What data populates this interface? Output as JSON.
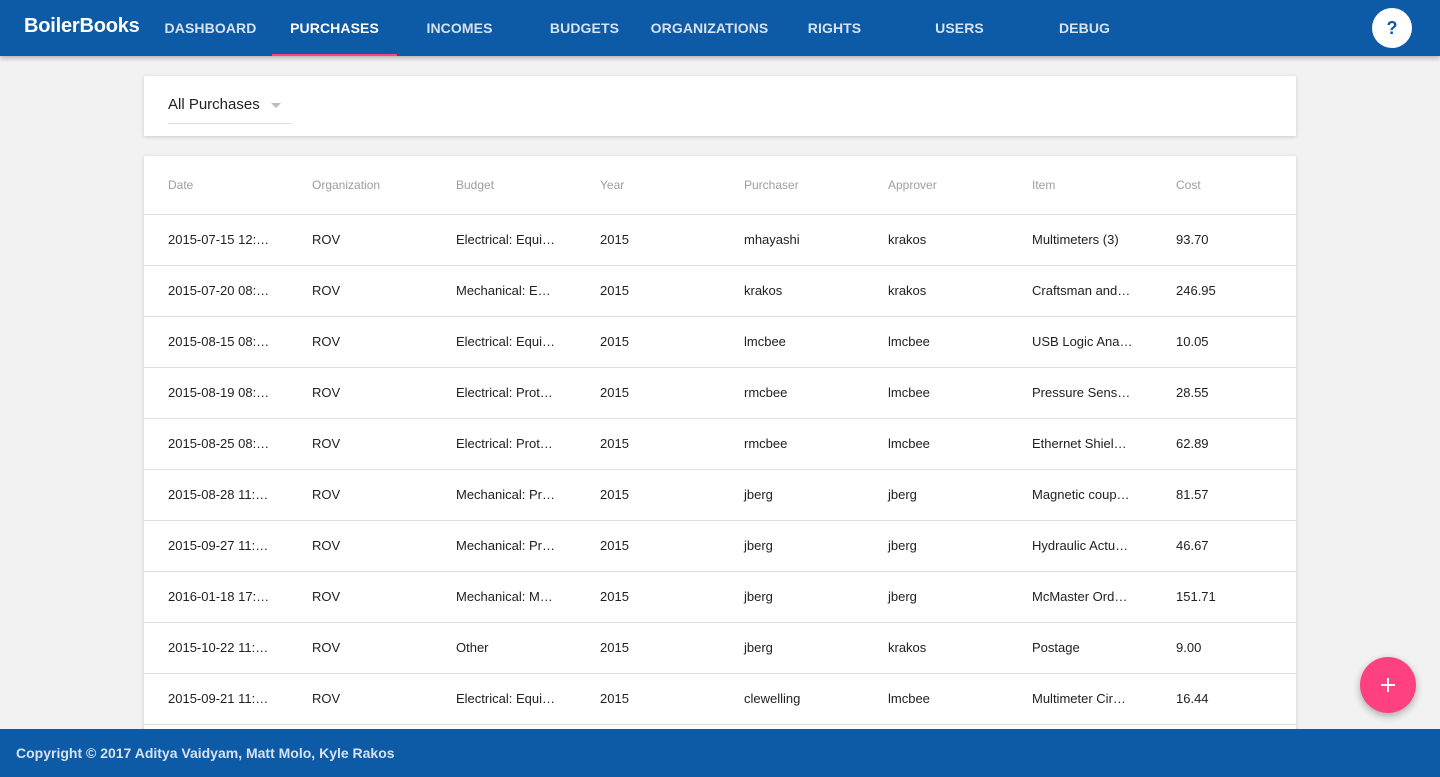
{
  "app": {
    "title": "BoilerBooks"
  },
  "nav": {
    "tabs": [
      {
        "label": "DASHBOARD"
      },
      {
        "label": "PURCHASES",
        "active": true
      },
      {
        "label": "INCOMES"
      },
      {
        "label": "BUDGETS"
      },
      {
        "label": "ORGANIZATIONS"
      },
      {
        "label": "RIGHTS"
      },
      {
        "label": "USERS"
      },
      {
        "label": "DEBUG"
      }
    ],
    "help_label": "?"
  },
  "filter": {
    "selected": "All Purchases"
  },
  "table": {
    "columns": [
      "Date",
      "Organization",
      "Budget",
      "Year",
      "Purchaser",
      "Approver",
      "Item",
      "Cost"
    ],
    "rows": [
      [
        "2015-07-15 12:…",
        "ROV",
        "Electrical: Equi…",
        "2015",
        "mhayashi",
        "krakos",
        "Multimeters (3)",
        "93.70"
      ],
      [
        "2015-07-20 08:…",
        "ROV",
        "Mechanical: E…",
        "2015",
        "krakos",
        "krakos",
        "Craftsman and…",
        "246.95"
      ],
      [
        "2015-08-15 08:…",
        "ROV",
        "Electrical: Equi…",
        "2015",
        "lmcbee",
        "lmcbee",
        "USB Logic Ana…",
        "10.05"
      ],
      [
        "2015-08-19 08:…",
        "ROV",
        "Electrical: Prot…",
        "2015",
        "rmcbee",
        "lmcbee",
        "Pressure Sens…",
        "28.55"
      ],
      [
        "2015-08-25 08:…",
        "ROV",
        "Electrical: Prot…",
        "2015",
        "rmcbee",
        "lmcbee",
        "Ethernet Shiel…",
        "62.89"
      ],
      [
        "2015-08-28 11:…",
        "ROV",
        "Mechanical: Pr…",
        "2015",
        "jberg",
        "jberg",
        "Magnetic coup…",
        "81.57"
      ],
      [
        "2015-09-27 11:…",
        "ROV",
        "Mechanical: Pr…",
        "2015",
        "jberg",
        "jberg",
        "Hydraulic Actu…",
        "46.67"
      ],
      [
        "2016-01-18 17:…",
        "ROV",
        "Mechanical: M…",
        "2015",
        "jberg",
        "jberg",
        "McMaster Ord…",
        "151.71"
      ],
      [
        "2015-10-22 11:…",
        "ROV",
        "Other",
        "2015",
        "jberg",
        "krakos",
        "Postage",
        "9.00"
      ],
      [
        "2015-09-21 11:…",
        "ROV",
        "Electrical: Equi…",
        "2015",
        "clewelling",
        "lmcbee",
        "Multimeter Cir…",
        "16.44"
      ]
    ]
  },
  "footer": {
    "copyright": "Copyright © 2017 Aditya Vaidyam, Matt Molo, Kyle Rakos"
  },
  "colors": {
    "primary": "#0d5aa7",
    "accent": "#ff4081",
    "background": "#f2f2f2"
  },
  "icons": {
    "fab": "plus-icon",
    "filter_arrow": "caret-down-icon"
  }
}
